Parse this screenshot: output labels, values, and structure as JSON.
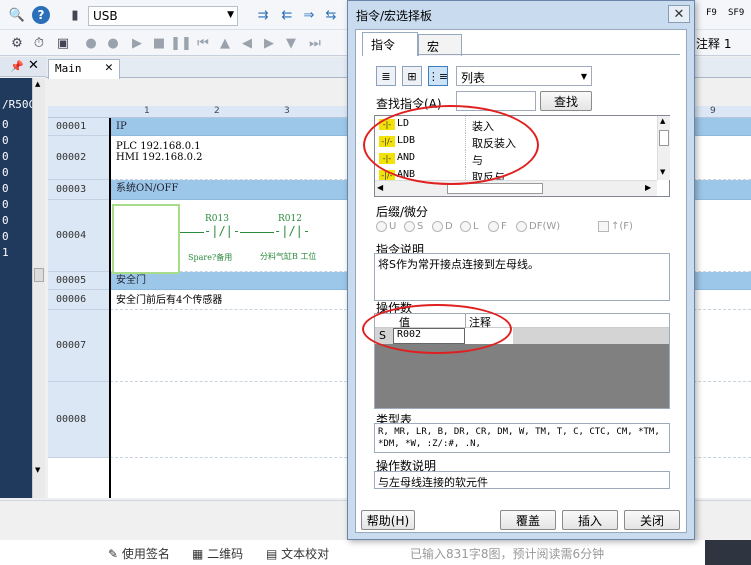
{
  "toolbar": {
    "connection": "USB",
    "right_label": "注释 1",
    "f9": "F9",
    "sf9": "SF9"
  },
  "left_panel": {
    "header": "/R50C",
    "values": [
      "0",
      "0",
      "0",
      "0",
      "0",
      "0",
      "0",
      "0",
      "1"
    ]
  },
  "tabs": {
    "main": "Main"
  },
  "grid": {
    "columns": [
      "1",
      "2",
      "3",
      "9"
    ],
    "rows": [
      {
        "num": "00001",
        "text": "IP",
        "header": true
      },
      {
        "num": "00002",
        "text": "PLC 192.168.0.1\nHMI 192.168.0.2",
        "header": false
      },
      {
        "num": "00003",
        "text": "系统ON/OFF",
        "header": true
      },
      {
        "num": "00004",
        "text": "",
        "header": false
      },
      {
        "num": "00005",
        "text": "安全门",
        "header": true
      },
      {
        "num": "00006",
        "text": "安全门前后有4个传感器",
        "header": false
      },
      {
        "num": "00007",
        "text": "",
        "header": false
      },
      {
        "num": "00008",
        "text": "",
        "header": false
      }
    ],
    "contacts": [
      {
        "addr": "R013",
        "comment": "Spare?备用"
      },
      {
        "addr": "R012",
        "comment": "分料气缸B 工位"
      }
    ]
  },
  "statusbar": {
    "items": [
      "使用签名",
      "二维码",
      "文本校对"
    ],
    "info": "已输入831字8图，预计阅读需6分钟"
  },
  "dialog": {
    "title": "指令/宏选择板",
    "close": "✕",
    "tab_instruction": "指令",
    "tab_macro": "宏",
    "view_select": "列表",
    "find_label": "查找指令(A)",
    "find_value": "",
    "find_button": "查找",
    "instructions": [
      {
        "icon": "-|-",
        "code": "LD",
        "desc": "装入"
      },
      {
        "icon": "-|/-",
        "code": "LDB",
        "desc": "取反装入"
      },
      {
        "icon": "-|-",
        "code": "AND",
        "desc": "与"
      },
      {
        "icon": "-|/-",
        "code": "ANB",
        "desc": "取反与"
      }
    ],
    "suffix_label": "后缀/微分",
    "suffix_options": [
      "U",
      "S",
      "D",
      "L",
      "F",
      "DF(W)"
    ],
    "suffix_checkbox": "↑(F)",
    "desc_label": "指令说明",
    "desc_text": "将S作为常开接点连接到左母线。",
    "operand_label": "操作数",
    "operand_cols": [
      "值",
      "注释"
    ],
    "operand_row": {
      "name": "S",
      "value": "R002",
      "comment": ""
    },
    "types_label": "类型表",
    "types_text": "R, MR, LR, B, DR, CR, DM, W, TM, T, C, CTC, CM, *TM, *DM, *W, :Z/:#, .N,",
    "opdesc_label": "操作数说明",
    "opdesc_text": "与左母线连接的软元件",
    "help_button": "帮助(H)",
    "overwrite_button": "覆盖",
    "insert_button": "插入",
    "close_button": "关闭"
  }
}
